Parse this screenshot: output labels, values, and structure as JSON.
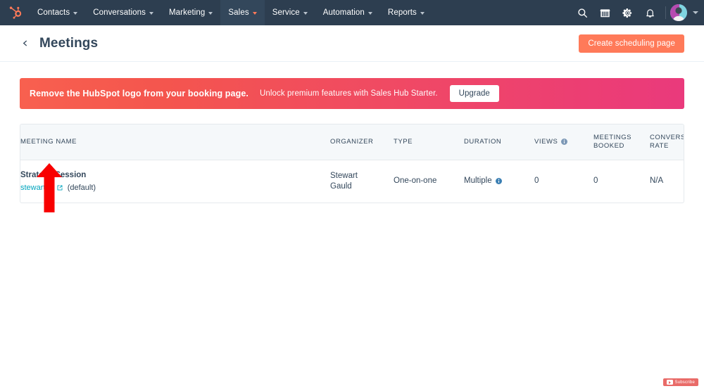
{
  "topnav": {
    "logo": "hubspot-sprocket-logo",
    "items": [
      {
        "label": "Contacts",
        "icon": "chevron-down-icon",
        "active": false
      },
      {
        "label": "Conversations",
        "icon": "chevron-down-icon",
        "active": false
      },
      {
        "label": "Marketing",
        "icon": "chevron-down-icon",
        "active": false
      },
      {
        "label": "Sales",
        "icon": "chevron-down-icon",
        "active": true
      },
      {
        "label": "Service",
        "icon": "chevron-down-icon",
        "active": false
      },
      {
        "label": "Automation",
        "icon": "chevron-down-icon",
        "active": false
      },
      {
        "label": "Reports",
        "icon": "chevron-down-icon",
        "active": false
      }
    ],
    "right_icons": [
      {
        "name": "search-icon"
      },
      {
        "name": "marketplace-icon"
      },
      {
        "name": "settings-gear-icon"
      },
      {
        "name": "notifications-bell-icon"
      }
    ],
    "avatar": "user-avatar",
    "avatar_caret": "chevron-down-icon",
    "background_color": "#2d3e50",
    "active_background_color": "#33475b",
    "accent_color": "#ff7a59"
  },
  "header": {
    "back_icon": "back-caret-icon",
    "title": "Meetings",
    "primary_button": "Create scheduling page",
    "primary_button_color": "#ff7a59"
  },
  "banner": {
    "headline": "Remove the HubSpot logo from your booking page.",
    "subtext": "Unlock premium features with Sales Hub Starter.",
    "button": "Upgrade",
    "gradient_start": "#f8604f",
    "gradient_end": "#ea3a7c"
  },
  "table": {
    "columns": [
      {
        "key": "name",
        "label": "MEETING NAME",
        "info": false
      },
      {
        "key": "organizer",
        "label": "ORGANIZER",
        "info": false
      },
      {
        "key": "type",
        "label": "TYPE",
        "info": false
      },
      {
        "key": "duration",
        "label": "DURATION",
        "info": false
      },
      {
        "key": "views",
        "label": "VIEWS",
        "info": true
      },
      {
        "key": "booked",
        "label": "MEETINGS\nBOOKED",
        "info": false
      },
      {
        "key": "conversion",
        "label": "CONVERSION\nRATE",
        "info": false
      }
    ],
    "rows": [
      {
        "name": "Strategy Session",
        "link_text": "stewart53",
        "link_icon": "external-link-icon",
        "default_tag": "(default)",
        "organizer": "Stewart\nGauld",
        "type": "One-on-one",
        "duration": "Multiple",
        "duration_info": "info-icon",
        "views": "0",
        "booked": "0",
        "conversion": "N/A"
      }
    ],
    "link_color": "#00a4bd",
    "header_background": "#f5f8fa"
  },
  "annotations": {
    "arrow": {
      "name": "red-arrow-annotation",
      "color": "#ff0000",
      "points_to": "stewart53"
    }
  },
  "overlay": {
    "subscribe_label": "Subscribe",
    "subscribe_icon": "youtube-play-icon",
    "subscribe_color": "#e96b68"
  }
}
